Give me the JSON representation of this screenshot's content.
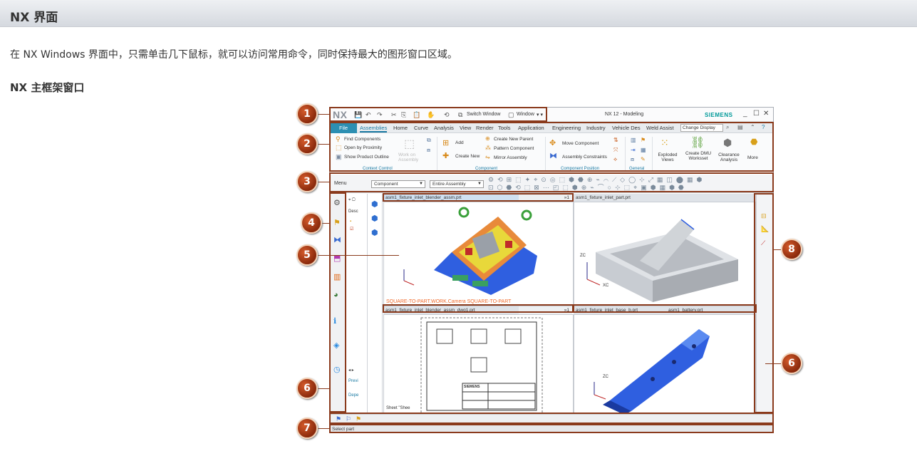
{
  "page": {
    "heading": "NX 界面",
    "intro": "在 NX Windows 界面中，只需单击几下鼠标，就可以访问常用命令，同时保持最大的图形窗口区域。",
    "section_title": "NX 主框架窗口"
  },
  "nx": {
    "logo": "NX",
    "quick_access": {
      "switch_window": "Switch Window",
      "window": "Window"
    },
    "window_title": "NX 12 - Modeling",
    "brand": "SIEMENS",
    "tabs": [
      "File",
      "Assemblies",
      "Home",
      "Curve",
      "Analysis",
      "View",
      "Render",
      "Tools",
      "Application",
      "Engineering",
      "Industry",
      "Vehicle Des",
      "Weld Assist"
    ],
    "active_tab": "Assemblies",
    "change_display": "Change Display",
    "ribbon": {
      "context_control": {
        "items": [
          "Find Components",
          "Open by Proximity",
          "Show Product Outline"
        ],
        "work_on_assembly": "Work on Assembly",
        "label": "Context Control"
      },
      "component": {
        "add": "Add",
        "create_new": "Create New",
        "items": [
          "Create New Parent",
          "Pattern Component",
          "Mirror Assembly"
        ],
        "label": "Component"
      },
      "component_position": {
        "items": [
          "Move Component",
          "Assembly Constraints"
        ],
        "label": "Component Position"
      },
      "general": {
        "label": "General"
      },
      "big_buttons": {
        "exploded_views": "Exploded Views",
        "create_dmu": "Create DMU Worksset",
        "clearance": "Clearance Analysis",
        "more": "More"
      }
    },
    "selection_bar": {
      "menu": "Menu",
      "filter": "Component",
      "scope": "Entire Assembly"
    },
    "nav_panel": {
      "header": "Desc",
      "preview": "Previ",
      "depend": "Depe"
    },
    "graphics": {
      "tab_top_left": "asm1_fixture_inlet_blender_assm.prt",
      "tab_top_right": "asm1_fixture_inlet_part.prt",
      "tab_bottom_left": "asm1_fixture_inlet_blender_assm_dwg1.prt",
      "tab_bottom_mid": "asm1_fixture_inlet_base_b.prt",
      "tab_bottom_right": "asm1_battery.prt",
      "tab_count": "»1",
      "camera_label": "SQUARE-TO-PART.WORK.Camera SQUARE-TO-PART",
      "sheet_label": "Sheet \"Shee",
      "drawing_brand": "SIEMENS",
      "axis_zc": "ZC",
      "axis_xc": "XC"
    },
    "status": "Select part"
  },
  "callouts": [
    "1",
    "2",
    "3",
    "4",
    "5",
    "6",
    "6",
    "7",
    "8"
  ],
  "colors": {
    "callout": "#a8401a",
    "file_tab": "#2c8fb2",
    "accent": "#1a7aa3",
    "model_blue": "#2f5fe0"
  }
}
